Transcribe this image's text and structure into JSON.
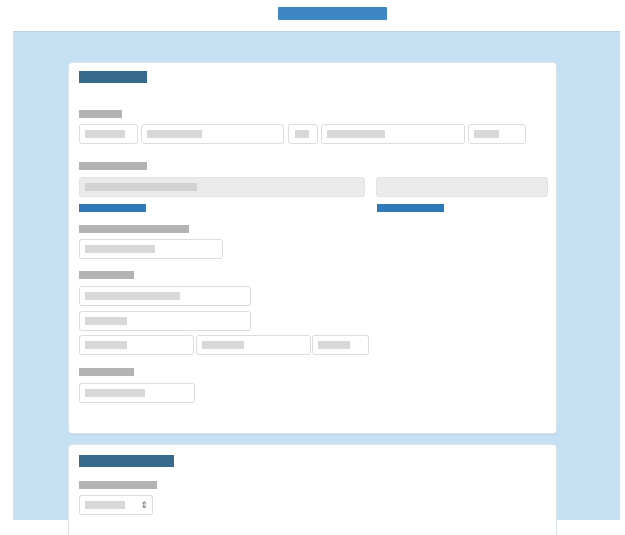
{
  "header": {
    "banner": ""
  },
  "section_1": {
    "title": "",
    "name_label": "",
    "name_fields": [
      "",
      "",
      "",
      "",
      ""
    ],
    "readonly_label": "",
    "readonly_fields": [
      "",
      ""
    ],
    "change_links": [
      "",
      ""
    ],
    "field3_label": "",
    "field3_value": "",
    "address_label": "",
    "address_lines": [
      "",
      ""
    ],
    "address_parts": [
      "",
      "",
      ""
    ],
    "field5_label": "",
    "field5_value": ""
  },
  "section_2": {
    "title": "",
    "select_label": "",
    "select_value": "",
    "chevron": "⇕"
  }
}
